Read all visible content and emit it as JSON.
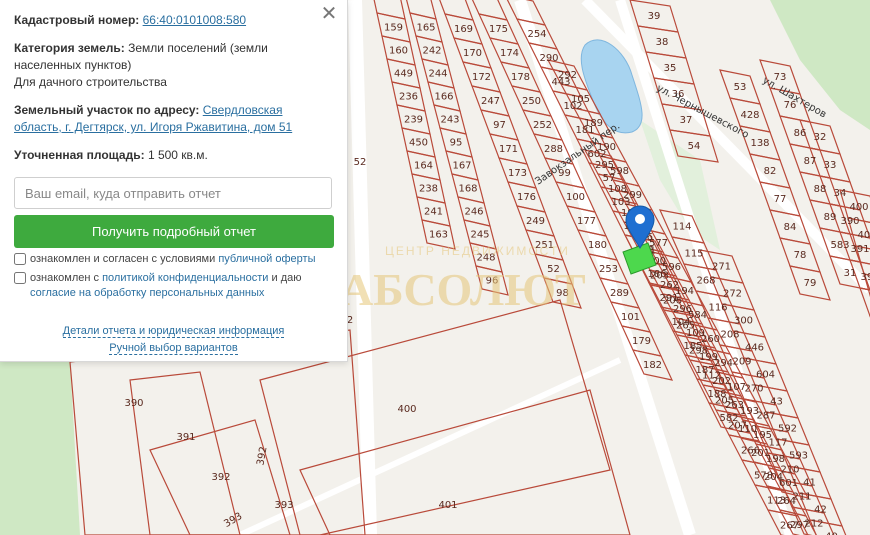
{
  "panel": {
    "cadastral_label": "Кадастровый номер:",
    "cadastral_number": "66:40:0101008:580",
    "category_label": "Категория земель:",
    "category_value_1": "Земли поселений (земли населенных пунктов)",
    "category_value_2": "Для дачного строительства",
    "address_label": "Земельный участок по адресу:",
    "address_value": "Свердловская область, г. Дегтярск, ул. Игоря Ржавитина, дом 51",
    "area_label": "Уточненная площадь:",
    "area_value": "1 500 кв.м.",
    "email_placeholder": "Ваш email, куда отправить отчет",
    "report_button": "Получить подробный отчет",
    "check1_text": "ознакомлен и согласен с условиями ",
    "check1_link": "публичной оферты",
    "check2_text": "ознакомлен с ",
    "check2_link1": "политикой конфиденциальности",
    "check2_mid": " и даю ",
    "check2_link2": "согласие на обработку персональных данных",
    "details_link": "Детали отчета и юридическая информация",
    "manual_link": "Ручной выбор вариантов",
    "close_symbol": "✕"
  },
  "map": {
    "watermark_text": "АБСОЛЮТ",
    "watermark_sub": "ЦЕНТР НЕДВИЖИМОСТИ",
    "colors": {
      "background": "#f3f1ec",
      "plot_stroke": "#b94a3a",
      "water": "#a8d4f0",
      "green": "#cfe8c4",
      "selected": "#4dd84d",
      "pin": "#1f6fd1",
      "road": "#ffffff"
    },
    "streets": [
      "ул. Шахтеров",
      "ул. Чернышевского",
      "Завокзальный пер."
    ],
    "plots": [
      "159",
      "160",
      "449",
      "236",
      "239",
      "450",
      "164",
      "238",
      "241",
      "163",
      "165",
      "242",
      "244",
      "166",
      "243",
      "95",
      "167",
      "168",
      "246",
      "245",
      "248",
      "96",
      "169",
      "170",
      "172",
      "247",
      "97",
      "171",
      "173",
      "176",
      "249",
      "251",
      "52",
      "98",
      "175",
      "174",
      "178",
      "250",
      "252",
      "288",
      "99",
      "100",
      "177",
      "180",
      "253",
      "289",
      "101",
      "179",
      "182",
      "254",
      "290",
      "443",
      "102",
      "181",
      "602",
      "57",
      "103",
      "184",
      "583",
      "186",
      "291",
      "104",
      "185",
      "187",
      "188",
      "582",
      "292",
      "105",
      "189",
      "190",
      "598",
      "299",
      "106",
      "577",
      "596",
      "194",
      "584",
      "260",
      "294",
      "107",
      "193",
      "195",
      "198",
      "601",
      "295",
      "108",
      "197",
      "196",
      "200",
      "262",
      "296",
      "109",
      "199",
      "202",
      "263",
      "110",
      "201",
      "204",
      "264",
      "297",
      "111",
      "203",
      "206",
      "265",
      "298",
      "112",
      "205",
      "207",
      "266",
      "578",
      "113",
      "267",
      "114",
      "115",
      "268",
      "116",
      "208",
      "209",
      "270",
      "287",
      "117",
      "210",
      "211",
      "212",
      "271",
      "272",
      "300",
      "446",
      "604",
      "43",
      "592",
      "593",
      "41",
      "42",
      "40",
      "39",
      "38",
      "35",
      "36",
      "37",
      "54",
      "53",
      "428",
      "138",
      "82",
      "77",
      "84",
      "78",
      "79",
      "73",
      "76",
      "86",
      "87",
      "88",
      "89",
      "583b",
      "31",
      "32",
      "33",
      "34",
      "390",
      "391",
      "392",
      "393",
      "400",
      "401"
    ]
  }
}
